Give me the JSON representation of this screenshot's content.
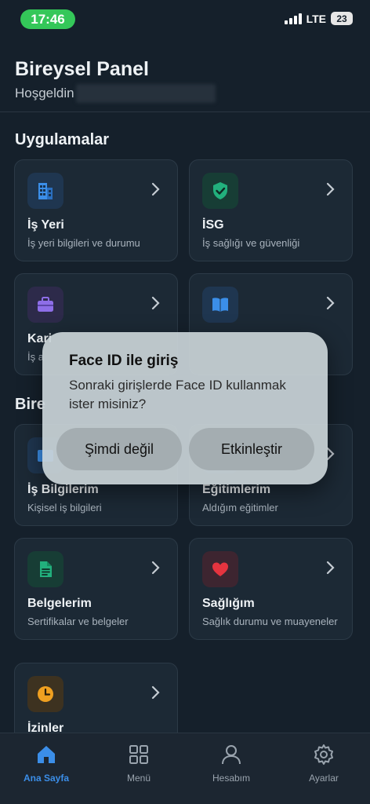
{
  "status_bar": {
    "time": "17:46",
    "network": "LTE",
    "battery": "23"
  },
  "header": {
    "title": "Bireysel Panel",
    "greeting": "Hoşgeldin"
  },
  "sections": {
    "apps": "Uygulamalar",
    "personal_partial": "Bire"
  },
  "apps": [
    {
      "title": "İş Yeri",
      "subtitle": "İş yeri bilgileri ve durumu",
      "icon": "building-icon"
    },
    {
      "title": "İSG",
      "subtitle": "İş sağlığı ve güvenliği",
      "icon": "shield-check-icon"
    },
    {
      "title": "Kari",
      "subtitle": "İş a",
      "icon": "briefcase-icon"
    },
    {
      "title": "",
      "subtitle": "",
      "icon": "book-icon"
    }
  ],
  "personal": [
    {
      "title": "İş Bilgilerim",
      "subtitle": "Kişisel iş bilgileri",
      "icon": "id-card-icon"
    },
    {
      "title": "Eğitimlerim",
      "subtitle": "Aldığım eğitimler",
      "icon": "graduation-icon"
    },
    {
      "title": "Belgelerim",
      "subtitle": "Sertifikalar ve belgeler",
      "icon": "document-icon"
    },
    {
      "title": "Sağlığım",
      "subtitle": "Sağlık durumu ve muayeneler",
      "icon": "heart-icon"
    },
    {
      "title": "İzinler",
      "subtitle": "",
      "icon": "clock-icon"
    }
  ],
  "dialog": {
    "title": "Face ID ile giriş",
    "message": "Sonraki girişlerde Face ID kullanmak ister misiniz?",
    "cancel": "Şimdi değil",
    "confirm": "Etkinleştir"
  },
  "tabs": [
    {
      "label": "Ana Sayfa",
      "icon": "home-icon",
      "active": true
    },
    {
      "label": "Menü",
      "icon": "grid-icon",
      "active": false
    },
    {
      "label": "Hesabım",
      "icon": "user-icon",
      "active": false
    },
    {
      "label": "Ayarlar",
      "icon": "gear-icon",
      "active": false
    }
  ],
  "colors": {
    "accent": "#3b8ee8",
    "status_green": "#34c759",
    "background": "#15202b",
    "card": "#1c2935"
  }
}
